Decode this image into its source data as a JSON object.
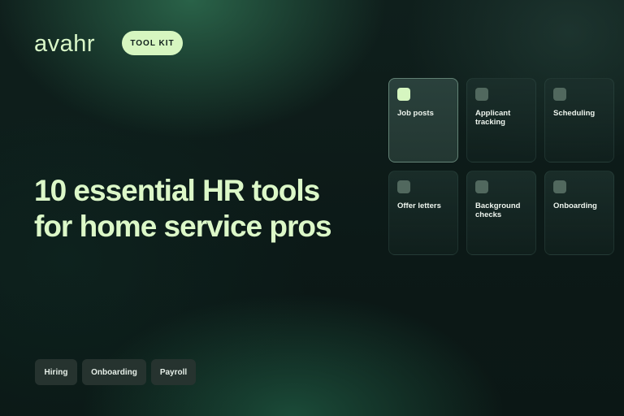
{
  "brand": {
    "logo_text": "avahr",
    "badge_label": "TOOL KIT"
  },
  "headline": {
    "line1": "10 essential HR tools",
    "line2": "for home service pros"
  },
  "tool_cards": [
    {
      "label": "Job posts",
      "selected": true
    },
    {
      "label": "Applicant tracking",
      "selected": false
    },
    {
      "label": "Scheduling",
      "selected": false
    },
    {
      "label": "Offer letters",
      "selected": false
    },
    {
      "label": "Background checks",
      "selected": false
    },
    {
      "label": "Onboarding",
      "selected": false
    }
  ],
  "tags": [
    {
      "label": "Hiring"
    },
    {
      "label": "Onboarding"
    },
    {
      "label": "Payroll"
    }
  ],
  "colors": {
    "accent": "#d6f6c0",
    "background": "#0c1816",
    "card": "#1c302c",
    "pill": "#26332f"
  }
}
